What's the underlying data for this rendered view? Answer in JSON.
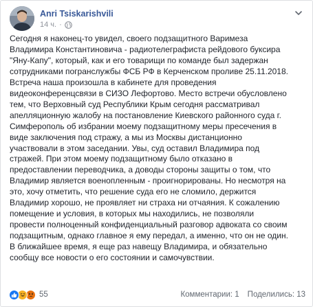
{
  "post": {
    "author": "Anri Tsiskarishvili",
    "time": "14 ч.",
    "separator": "·",
    "icons": [
      "avatar",
      "globe-icon",
      "chevron-down-icon"
    ],
    "body": "Сегодня я наконец-то увидел, своего подзащитного Варимеза\nВладимира Константиновича - радиотелеграфиста рейдового буксира\n\"Яну-Капу\", который, как и его товарищи по команде был задержан\nсотрудниками погранслужбы ФСБ РФ в Керченском проливе 25.11.2018.\nВстреча наша произошла в кабинете для проведения\nвидеоконференцсвязи в СИЗО Лефортово. Место встречи обусловлено\nтем, что Верховный суд Республики Крым сегодня рассматривал\nапелляционную жалобу на постановление Киевского районного суда г.\nСимферополь об избрании моему подзащитному меры пресечения в\nвиде заключения под стражу, а мы из Москвы дистанционно\nучаствовали в этом заседании. Увы, суд оставил Владимира под\nстражей. При этом моему подзащитному было отказано в\nпредоставлении переводчика, а доводы стороны защиты о том, что\nВладимир является военопленным - проигнорированы. Но несмотря на\nэто, хочу отметить, что решение суда его не сломило, держится\nВладимир хорошо, не проявляет ни страха ни отчаяния. К сожалению\nпомещение и условия, в которых мы находились, не позволяли\nпровести полноценный конфиденциальный разговор адвоката со своим\nподзащитным, однако главное я ему передал, а именно, что он не один.\nВ ближайшее время, я еще раз навещу Владимира, и обязательно\nсообщу все новости о его состоянии и самочувствии."
  },
  "footer": {
    "reactions_count": "55",
    "reaction_icons": [
      "like-icon",
      "haha-icon",
      "angry-icon"
    ],
    "comments": "Комментарии: 1",
    "shares": "Поделились: 13"
  },
  "colors": {
    "author_link": "#385898",
    "meta_gray": "#90949c",
    "like_blue": "#1877f2",
    "haha_yellow": "#f7b125",
    "angry_orange": "#e9710f"
  }
}
